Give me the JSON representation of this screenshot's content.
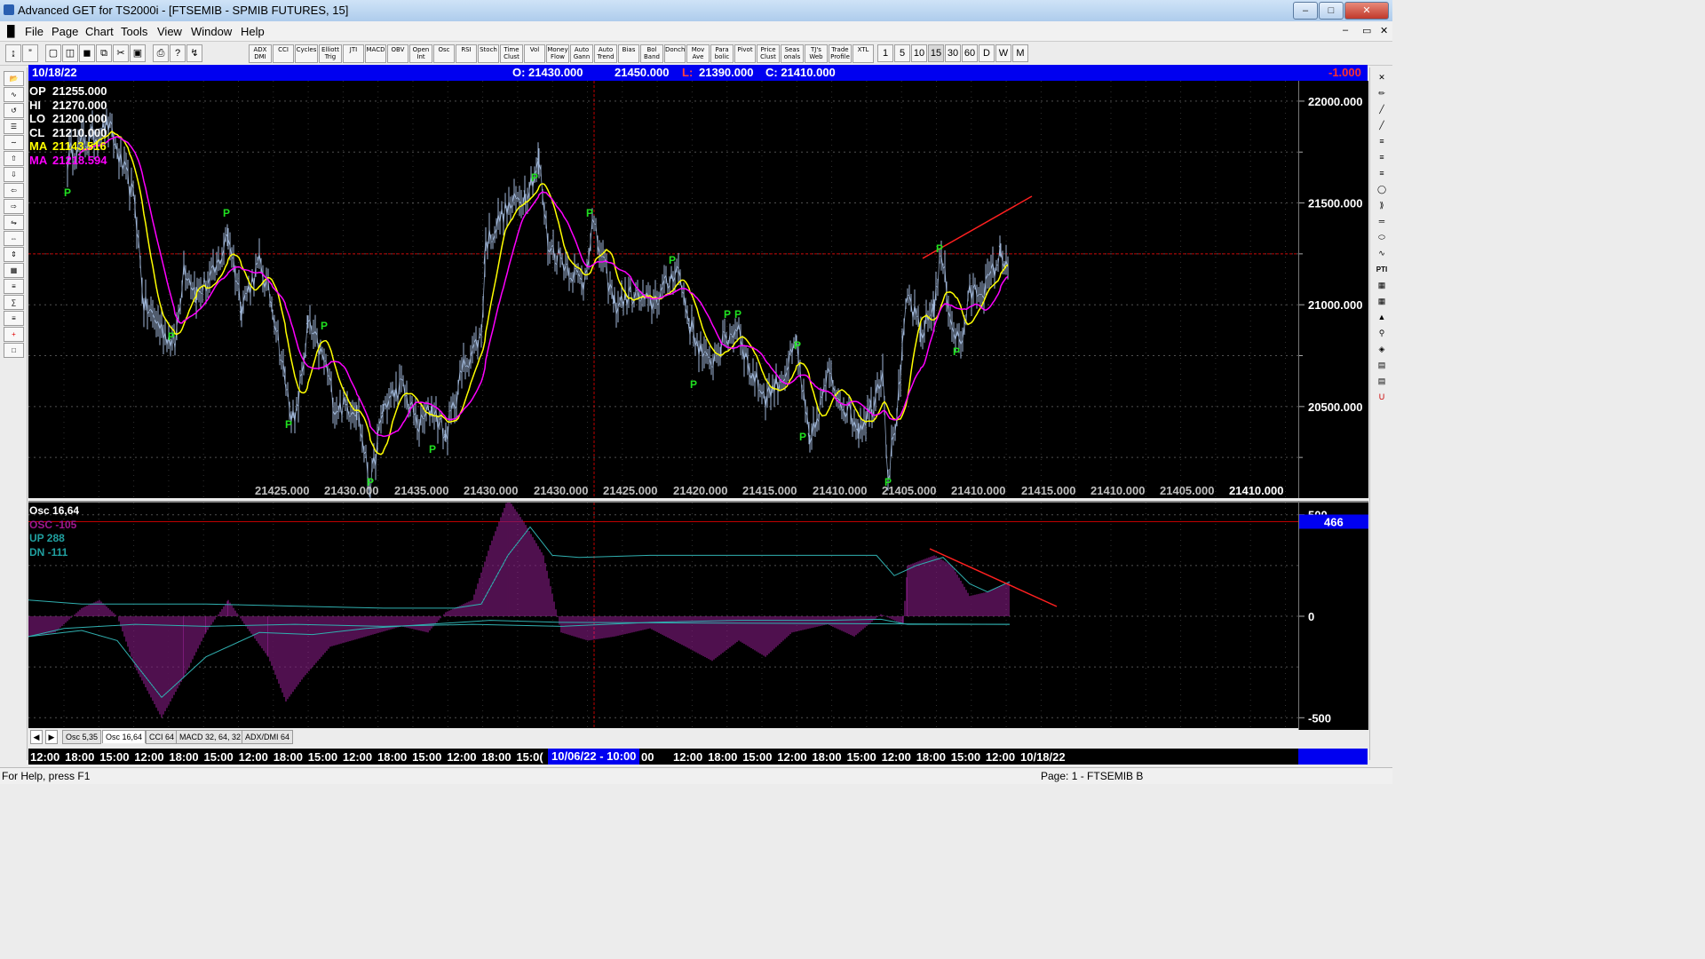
{
  "window": {
    "title": "Advanced GET for TS2000i - [FTSEMIB - SPMIB FUTURES, 15]"
  },
  "menu": [
    "File",
    "Page",
    "Chart",
    "Tools",
    "View",
    "Window",
    "Help"
  ],
  "toolbar": {
    "indicators": [
      "ADX DMI",
      "CCI",
      "Cycles",
      "Elliott Trig",
      "JTI",
      "MACD",
      "OBV",
      "Open Int",
      "Osc",
      "RSI",
      "Stoch",
      "Time Clust",
      "Vol",
      "Money Flow",
      "Auto Gann",
      "Auto Trend",
      "Bias",
      "Bol Band",
      "Donch",
      "Mov Ave",
      "Para bolic",
      "Pivot",
      "Price Clust",
      "Seas onals",
      "TJ's Web",
      "Trade Profile",
      "XTL"
    ],
    "intervals": [
      "1",
      "5",
      "10",
      "15",
      "30",
      "60",
      "D",
      "W",
      "M"
    ]
  },
  "infobar": {
    "date": "10/18/22",
    "open": "O: 21430.000",
    "high": "21450.000",
    "low_label": "L:",
    "low": "21390.000",
    "close": "C: 21410.000",
    "change": "-1.000"
  },
  "legend": [
    {
      "label": "OP",
      "value": "21255.000",
      "color": "#ffffff"
    },
    {
      "label": "HI",
      "value": "21270.000",
      "color": "#ffffff"
    },
    {
      "label": "LO",
      "value": "21200.000",
      "color": "#ffffff"
    },
    {
      "label": "CL",
      "value": "21210.000",
      "color": "#ffffff"
    },
    {
      "label": "MA",
      "value": "21143.516",
      "color": "#ffff00"
    },
    {
      "label": "MA",
      "value": "21218.594",
      "color": "#ff00ff"
    }
  ],
  "pivot_label": "P",
  "price_axis": [
    "22000.000",
    "21500.000",
    "21000.000",
    "20500.000"
  ],
  "bottom_price_labels": [
    "21425.000",
    "21430.000",
    "21435.000",
    "21430.000",
    "21430.000",
    "21425.000",
    "21420.000",
    "21415.000",
    "21410.000",
    "21405.000",
    "21410.000",
    "21415.000",
    "21410.000",
    "21405.000",
    "21410.000"
  ],
  "osc_legend": [
    {
      "label": "Osc 16,64",
      "color": "#ffffff"
    },
    {
      "label": "OSC -105",
      "color": "#a01890"
    },
    {
      "label": "UP  288",
      "color": "#20a0a0"
    },
    {
      "label": "DN  -111",
      "color": "#20a0a0"
    }
  ],
  "osc_axis": [
    "500",
    "0",
    "-500"
  ],
  "osc_marker": "466",
  "tabs": [
    "Osc 5,35",
    "Osc 16,64",
    "CCI 64",
    "MACD 32, 64, 32",
    "ADX/DMI 64"
  ],
  "time_axis": [
    "12:00",
    "18:00",
    "15:00",
    "12:00",
    "18:00",
    "15:00",
    "12:00",
    "18:00",
    "15:00",
    "12:00",
    "18:00",
    "15:00",
    "12:00",
    "18:00",
    "15:0("
  ],
  "time_highlight": "10/06/22 - 10:00",
  "time_axis_right": [
    "00",
    "12:00",
    "18:00",
    "15:00",
    "12:00",
    "18:00",
    "15:00",
    "12:00",
    "18:00",
    "15:00",
    "12:00",
    "10/18/22"
  ],
  "status": {
    "left": "For Help, press F1",
    "right": "Page: 1 - FTSEMIB B"
  },
  "chart_data": {
    "type": "line",
    "price_ylim": [
      20050,
      22100
    ],
    "osc_ylim": [
      -560,
      560
    ]
  }
}
